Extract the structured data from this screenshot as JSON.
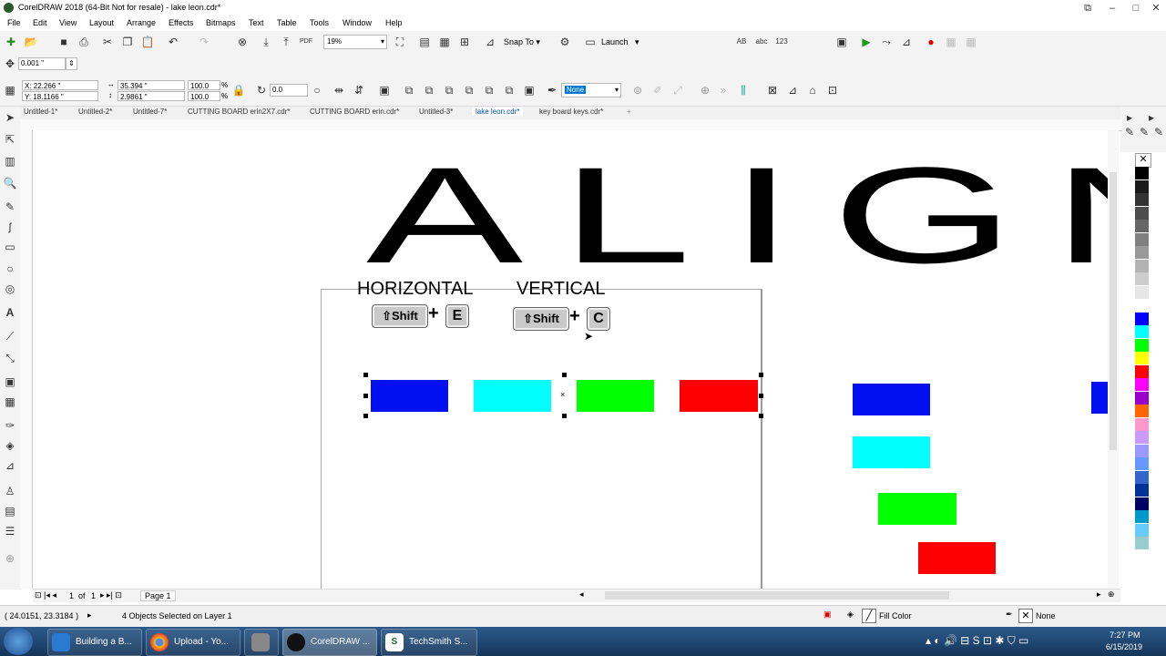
{
  "window": {
    "title": "CorelDRAW 2018 (64-Bit Not for resale) - lake leon.cdr*"
  },
  "menu": [
    "File",
    "Edit",
    "View",
    "Layout",
    "Arrange",
    "Effects",
    "Bitmaps",
    "Text",
    "Table",
    "Tools",
    "Window",
    "Help"
  ],
  "toolbar": {
    "zoom": "19%",
    "snap_to": "Snap To",
    "launch": "Launch"
  },
  "property_bar": {
    "nudge": "0.001 \"",
    "x": "X: 22.266 \"",
    "y": "Y: 18.1166 \"",
    "width": "35.394 \"",
    "height": "2.9861 \"",
    "scale_x": "100.0",
    "scale_y": "100.0",
    "percent": "%",
    "rotation": "0.0",
    "outline": "None"
  },
  "doc_tabs": [
    "Untitled-1*",
    "Untitled-2*",
    "Untitled-7*",
    "CUTTING BOARD erin2X7.cdr*",
    "CUTTING BOARD erin.cdr*",
    "Untitled-3*",
    "lake leon.cdr*",
    "key board keys.cdr*"
  ],
  "active_tab": "lake leon.cdr*",
  "canvas": {
    "heading": "ALIGN",
    "horizontal_label": "HORIZONTAL",
    "vertical_label": "VERTICAL",
    "shift_key": "Shift",
    "plus": "+",
    "key_e": "E",
    "key_c": "C",
    "center_mark": "×"
  },
  "colors": {
    "blue": "#0010f0",
    "cyan": "#00ffff",
    "green": "#00ff00",
    "red": "#ff0000",
    "accent": "#0078d7"
  },
  "page_nav": {
    "current": "1",
    "of": "of",
    "total": "1",
    "page_tab": "Page 1"
  },
  "status": {
    "cursor": "( 24.0151, 23.3184 )",
    "selection": "4 Objects Selected on Layer 1",
    "fill": "Fill Color",
    "outline": "None"
  },
  "taskbar": {
    "items": [
      "Building a B...",
      "Upload - Yo...",
      "",
      "CorelDRAW ...",
      "TechSmith S..."
    ],
    "time": "7:27 PM",
    "date": "6/15/2019"
  },
  "palette": [
    "#000000",
    "#1a1a1a",
    "#333333",
    "#4d4d4d",
    "#666666",
    "#808080",
    "#999999",
    "#b3b3b3",
    "#cccccc",
    "#e6e6e6",
    "#ffffff",
    "#0000ff",
    "#00ffff",
    "#00ff00",
    "#ffff00",
    "#ff0000",
    "#ff00ff",
    "#9900cc",
    "#ff6600",
    "#ff99cc",
    "#cc99ff",
    "#9999ff",
    "#6699ff",
    "#3366cc",
    "#003399",
    "#000066",
    "#0099cc",
    "#66ccff",
    "#99cccc"
  ]
}
